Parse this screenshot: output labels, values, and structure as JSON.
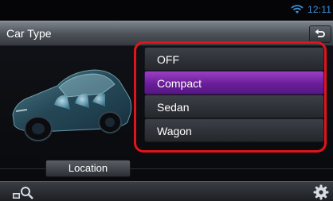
{
  "status_bar": {
    "time": "12:11",
    "wifi_icon": "wifi-icon"
  },
  "header": {
    "title": "Car Type",
    "back_icon": "back-arrow-icon"
  },
  "car_type_options": [
    {
      "label": "OFF",
      "selected": false
    },
    {
      "label": "Compact",
      "selected": true
    },
    {
      "label": "Sedan",
      "selected": false
    },
    {
      "label": "Wagon",
      "selected": false
    }
  ],
  "location_button": {
    "label": "Location"
  },
  "bottom_bar": {
    "left_icon": "search-icon",
    "right_icon": "gear-icon"
  },
  "colors": {
    "accent_selected": "#7a2aab",
    "highlight_border": "#e0141b",
    "clock_blue": "#3e8fd8"
  }
}
